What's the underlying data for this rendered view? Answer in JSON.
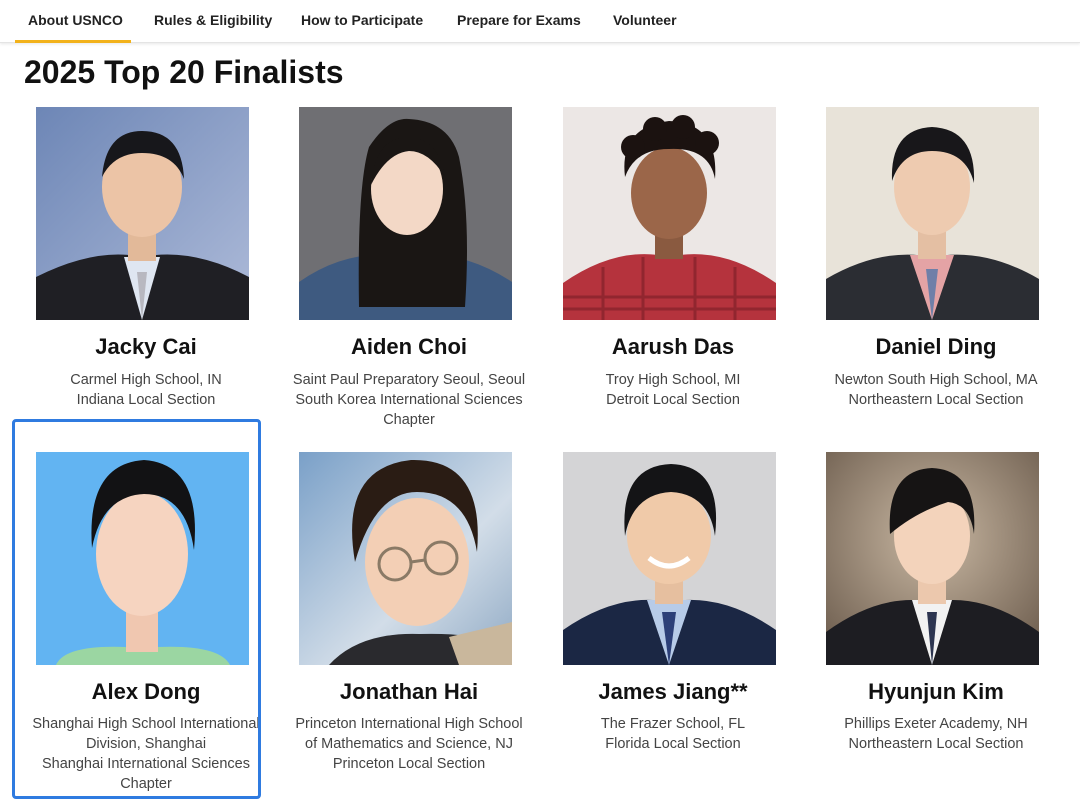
{
  "nav": {
    "items": [
      {
        "label": "About USNCO",
        "active": true
      },
      {
        "label": "Rules & Eligibility",
        "active": false
      },
      {
        "label": "How to Participate",
        "active": false
      },
      {
        "label": "Prepare for Exams",
        "active": false
      },
      {
        "label": "Volunteer",
        "active": false
      }
    ],
    "accent_color": "#f2b21b"
  },
  "page": {
    "title": "2025 Top 20 Finalists"
  },
  "selection_color": "#2f7be0",
  "finalists": [
    {
      "name": "Jacky Cai",
      "lines": [
        "Carmel High School, IN",
        "Indiana Local Section"
      ]
    },
    {
      "name": "Aiden Choi",
      "lines": [
        "Saint Paul Preparatory Seoul, Seoul",
        "South Korea International Sciences",
        "Chapter"
      ]
    },
    {
      "name": "Aarush Das",
      "lines": [
        "Troy High School, MI",
        "Detroit Local Section"
      ]
    },
    {
      "name": "Daniel Ding",
      "lines": [
        "Newton South High School, MA",
        "Northeastern Local Section"
      ]
    },
    {
      "name": "Alex Dong",
      "lines": [
        "Shanghai High School International",
        "Division, Shanghai",
        "Shanghai International Sciences",
        "Chapter"
      ],
      "selected": true
    },
    {
      "name": "Jonathan Hai",
      "lines": [
        "Princeton International High School",
        "of Mathematics and Science, NJ",
        "Princeton Local Section"
      ]
    },
    {
      "name": "James Jiang**",
      "lines": [
        "The Frazer School, FL",
        "Florida Local Section"
      ]
    },
    {
      "name": "Hyunjun Kim",
      "lines": [
        "Phillips Exeter Academy, NH",
        "Northeastern Local Section"
      ]
    }
  ]
}
